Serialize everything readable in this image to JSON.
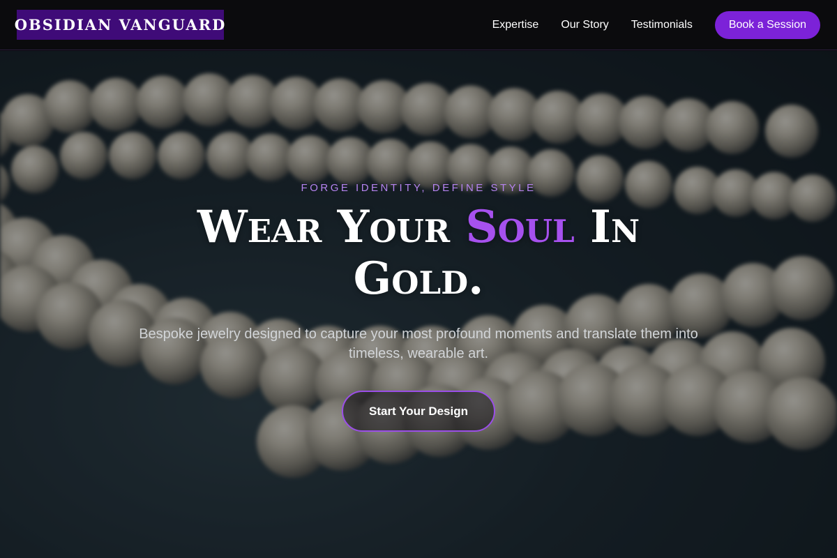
{
  "header": {
    "logo_text": "OBSIDIAN VANGUARD",
    "nav": {
      "expertise": "Expertise",
      "our_story": "Our Story",
      "testimonials": "Testimonials"
    },
    "cta_label": "Book a Session"
  },
  "hero": {
    "background_image": "blurred-pearl-necklace",
    "eyebrow": "FORGE IDENTITY, DEFINE STYLE",
    "headline": {
      "part1": "Wear Your",
      "accent": "Soul",
      "part2": "In Gold."
    },
    "subhead": "Bespoke jewelry designed to capture your most profound moments and translate them into timeless, wearable art.",
    "cta_label": "Start Your Design"
  },
  "colors": {
    "brand_purple": "#7c22d8",
    "logo_bg": "#3f0b78",
    "accent_text": "#a651ee",
    "eyebrow_text": "#b583ef",
    "header_bg": "#0b0b0d"
  }
}
